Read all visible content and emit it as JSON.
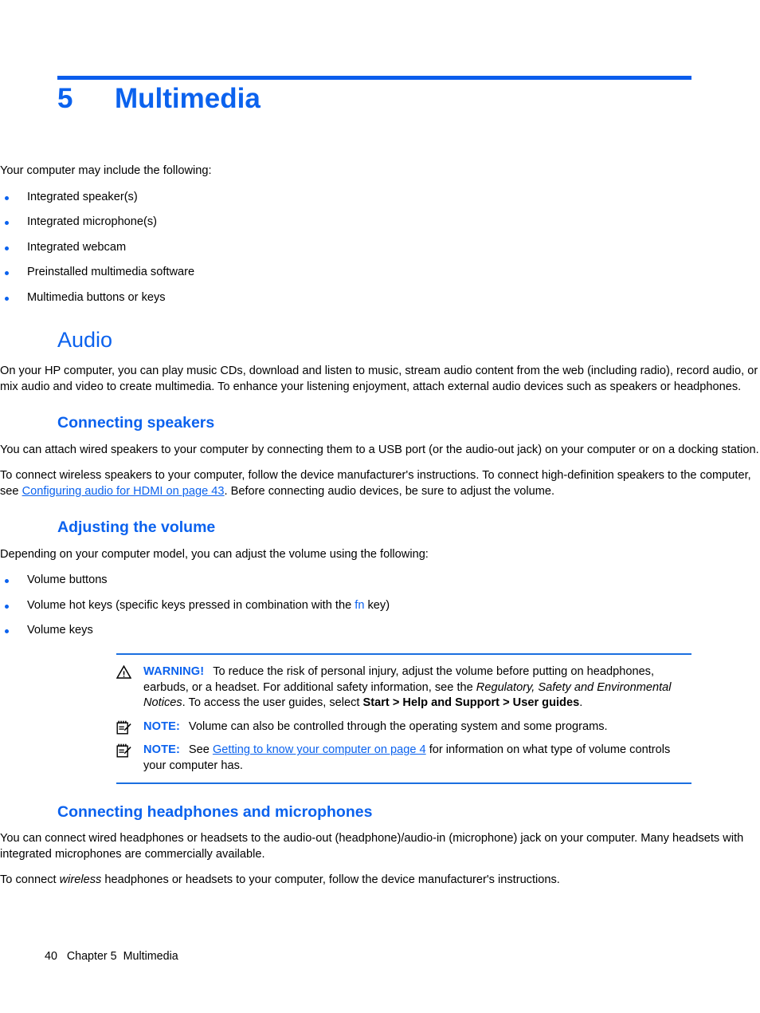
{
  "chapter": {
    "number": "5",
    "title": "Multimedia"
  },
  "intro": {
    "lead": "Your computer may include the following:",
    "bullets": [
      "Integrated speaker(s)",
      "Integrated microphone(s)",
      "Integrated webcam",
      "Preinstalled multimedia software",
      "Multimedia buttons or keys"
    ]
  },
  "audio": {
    "heading": "Audio",
    "paragraph": "On your HP computer, you can play music CDs, download and listen to music, stream audio content from the web (including radio), record audio, or mix audio and video to create multimedia. To enhance your listening enjoyment, attach external audio devices such as speakers or headphones."
  },
  "connecting_speakers": {
    "heading": "Connecting speakers",
    "paragraph1": "You can attach wired speakers to your computer by connecting them to a USB port (or the audio-out jack) on your computer or on a docking station.",
    "paragraph2_before": "To connect wireless speakers to your computer, follow the device manufacturer's instructions. To connect high-definition speakers to the computer, see ",
    "paragraph2_link": "Configuring audio for HDMI on page 43",
    "paragraph2_after": ". Before connecting audio devices, be sure to adjust the volume."
  },
  "adjusting_volume": {
    "heading": "Adjusting the volume",
    "lead": "Depending on your computer model, you can adjust the volume using the following:",
    "bullet1": "Volume buttons",
    "bullet2_before": "Volume hot keys (specific keys pressed in combination with the ",
    "bullet2_key": "fn",
    "bullet2_after": " key)",
    "bullet3": "Volume keys"
  },
  "callouts": {
    "warning": {
      "icon": "warning-triangle-icon",
      "label": "WARNING!",
      "text_before": "To reduce the risk of personal injury, adjust the volume before putting on headphones, earbuds, or a headset. For additional safety information, see the ",
      "italic_title": "Regulatory, Safety and Environmental Notices",
      "text_middle": ". To access the user guides, select ",
      "bold_path": "Start > Help and Support > User guides",
      "text_after": "."
    },
    "note1": {
      "icon": "note-pad-icon",
      "label": "NOTE:",
      "text": "Volume can also be controlled through the operating system and some programs."
    },
    "note2": {
      "icon": "note-pad-icon",
      "label": "NOTE:",
      "text_before": "See ",
      "link": "Getting to know your computer on page 4",
      "text_after": " for information on what type of volume controls your computer has."
    }
  },
  "connecting_headphones": {
    "heading": "Connecting headphones and microphones",
    "paragraph1": "You can connect wired headphones or headsets to the audio-out (headphone)/audio-in (microphone) jack on your computer. Many headsets with integrated microphones are commercially available.",
    "paragraph2_before": "To connect ",
    "paragraph2_italic": "wireless",
    "paragraph2_after": " headphones or headsets to your computer, follow the device manufacturer's instructions."
  },
  "footer": {
    "page_number": "40",
    "chapter_label": "Chapter 5",
    "chapter_title": "Multimedia"
  },
  "colors": {
    "accent_blue": "#0b62ee",
    "rule_blue": "#1a6fe0",
    "text_black": "#000000"
  }
}
